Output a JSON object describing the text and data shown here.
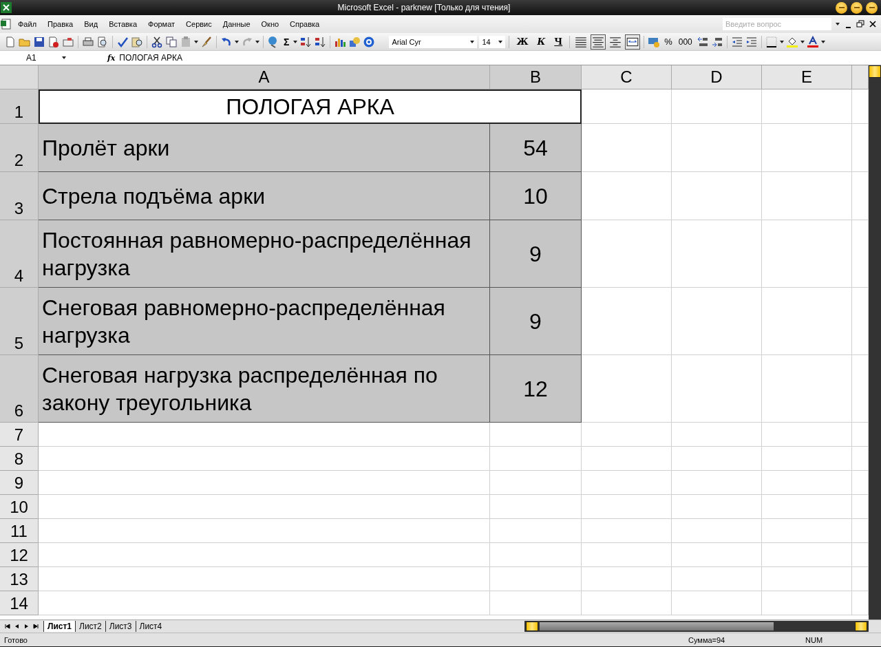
{
  "window": {
    "title": "Microsoft Excel - parknew  [Только для чтения]"
  },
  "menu": [
    "Файл",
    "Правка",
    "Вид",
    "Вставка",
    "Формат",
    "Сервис",
    "Данные",
    "Окно",
    "Справка"
  ],
  "help": {
    "placeholder": "Введите вопрос"
  },
  "toolbar": {
    "autosum": "Σ",
    "font": "Arial Cyr",
    "size": "14",
    "styles": [
      "Ж",
      "К",
      "Ч"
    ],
    "alignment": [
      {
        "selected": false
      },
      {
        "selected": true
      },
      {
        "selected": false
      }
    ],
    "merge": {
      "selected": true
    },
    "percent": "%",
    "thousands": "000"
  },
  "formula_bar": {
    "name_box": "A1",
    "function_label": "fx",
    "formula": "ПОЛОГАЯ АРКА"
  },
  "columns": [
    {
      "label": "A",
      "selected": true
    },
    {
      "label": "B",
      "selected": true
    },
    {
      "label": "C",
      "selected": false
    },
    {
      "label": "D",
      "selected": false
    },
    {
      "label": "E",
      "selected": false
    }
  ],
  "rows": [
    {
      "label": "1",
      "selected": true,
      "shaded": false,
      "merged": true,
      "a": "ПОЛОГАЯ АРКА"
    },
    {
      "label": "2",
      "selected": true,
      "shaded": true,
      "a": "Пролёт арки",
      "b": "54"
    },
    {
      "label": "3",
      "selected": true,
      "shaded": true,
      "a": "Стрела подъёма арки",
      "b": "10"
    },
    {
      "label": "4",
      "selected": true,
      "shaded": true,
      "a": "Постоянная равномерно-распределённая нагрузка",
      "b": "9"
    },
    {
      "label": "5",
      "selected": true,
      "shaded": true,
      "a": "Снеговая равномерно-распределённая нагрузка",
      "b": "9"
    },
    {
      "label": "6",
      "selected": true,
      "shaded": true,
      "a": "Снеговая нагрузка распределённая по закону треугольника",
      "b": "12"
    },
    {
      "label": "7",
      "selected": false
    },
    {
      "label": "8",
      "selected": false
    },
    {
      "label": "9",
      "selected": false
    },
    {
      "label": "10",
      "selected": false
    },
    {
      "label": "11",
      "selected": false
    },
    {
      "label": "12",
      "selected": false
    },
    {
      "label": "13",
      "selected": false
    },
    {
      "label": "14",
      "selected": false
    }
  ],
  "sheets": [
    {
      "label": "Лист1",
      "selected": true
    },
    {
      "label": "Лист2",
      "selected": false
    },
    {
      "label": "Лист3",
      "selected": false
    },
    {
      "label": "Лист4",
      "selected": false
    }
  ],
  "status_bar": {
    "state": "Готово",
    "sum": "Сумма=94",
    "mode": "NUM"
  }
}
